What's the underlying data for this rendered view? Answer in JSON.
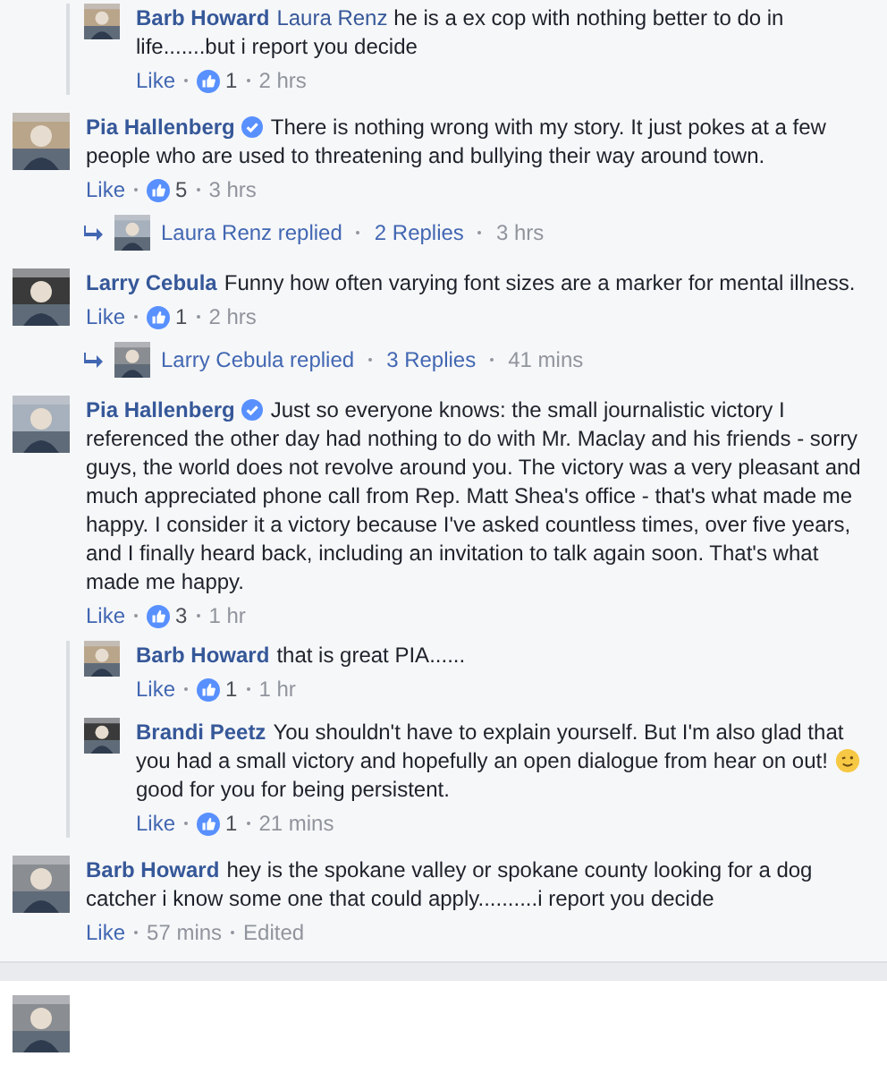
{
  "threads": [
    {
      "replies": [
        {
          "author": "Barb Howard",
          "verified": false,
          "mention": "Laura Renz",
          "text_parts": [
            "he is a ex cop with nothing better to do in life.......but i report you decide"
          ],
          "like": "Like",
          "reactions": "1",
          "time": "2 hrs"
        }
      ]
    },
    {
      "comment": {
        "author": "Pia Hallenberg",
        "verified": true,
        "text_parts": [
          "There is nothing wrong with my story. It just pokes at a few people who are used to threatening and bullying their way around town."
        ],
        "like": "Like",
        "reactions": "5",
        "time": "3 hrs"
      },
      "summary": {
        "author": "Laura Renz replied",
        "count": "2 Replies",
        "time": "3 hrs"
      }
    },
    {
      "comment": {
        "author": "Larry Cebula",
        "verified": false,
        "text_parts": [
          "Funny how often varying font sizes are a marker for mental illness."
        ],
        "like": "Like",
        "reactions": "1",
        "time": "2 hrs"
      },
      "summary": {
        "author": "Larry Cebula replied",
        "count": "3 Replies",
        "time": "41 mins"
      }
    },
    {
      "comment": {
        "author": "Pia Hallenberg",
        "verified": true,
        "text_parts": [
          "Just so everyone knows: the small journalistic victory I referenced the other day had nothing to do with Mr. Maclay and his friends - sorry guys, the world does not revolve around you. The victory was a very pleasant and much appreciated phone call from Rep. Matt Shea's office - that's what made me happy. I consider it a victory because I've asked countless times, over five years, and I finally heard back, including an invitation to talk again soon. That's what made me happy."
        ],
        "like": "Like",
        "reactions": "3",
        "time": "1 hr"
      },
      "replies": [
        {
          "author": "Barb Howard",
          "verified": false,
          "text_parts": [
            "that is great PIA......"
          ],
          "like": "Like",
          "reactions": "1",
          "time": "1 hr"
        },
        {
          "author": "Brandi Peetz",
          "verified": false,
          "text_parts": [
            "You shouldn't have to explain yourself. But I'm also glad that you had a small victory and hopefully an open dialogue from hear on out!",
            "good for you for being persistent."
          ],
          "like": "Like",
          "reactions": "1",
          "time": "21 mins"
        }
      ]
    },
    {
      "comment": {
        "author": "Barb Howard",
        "verified": false,
        "text_parts": [
          "hey is the spokane valley or spokane county looking for a dog catcher i know some one that could apply..........i report you decide"
        ],
        "like": "Like",
        "time": "57 mins",
        "edited": "Edited"
      }
    }
  ]
}
